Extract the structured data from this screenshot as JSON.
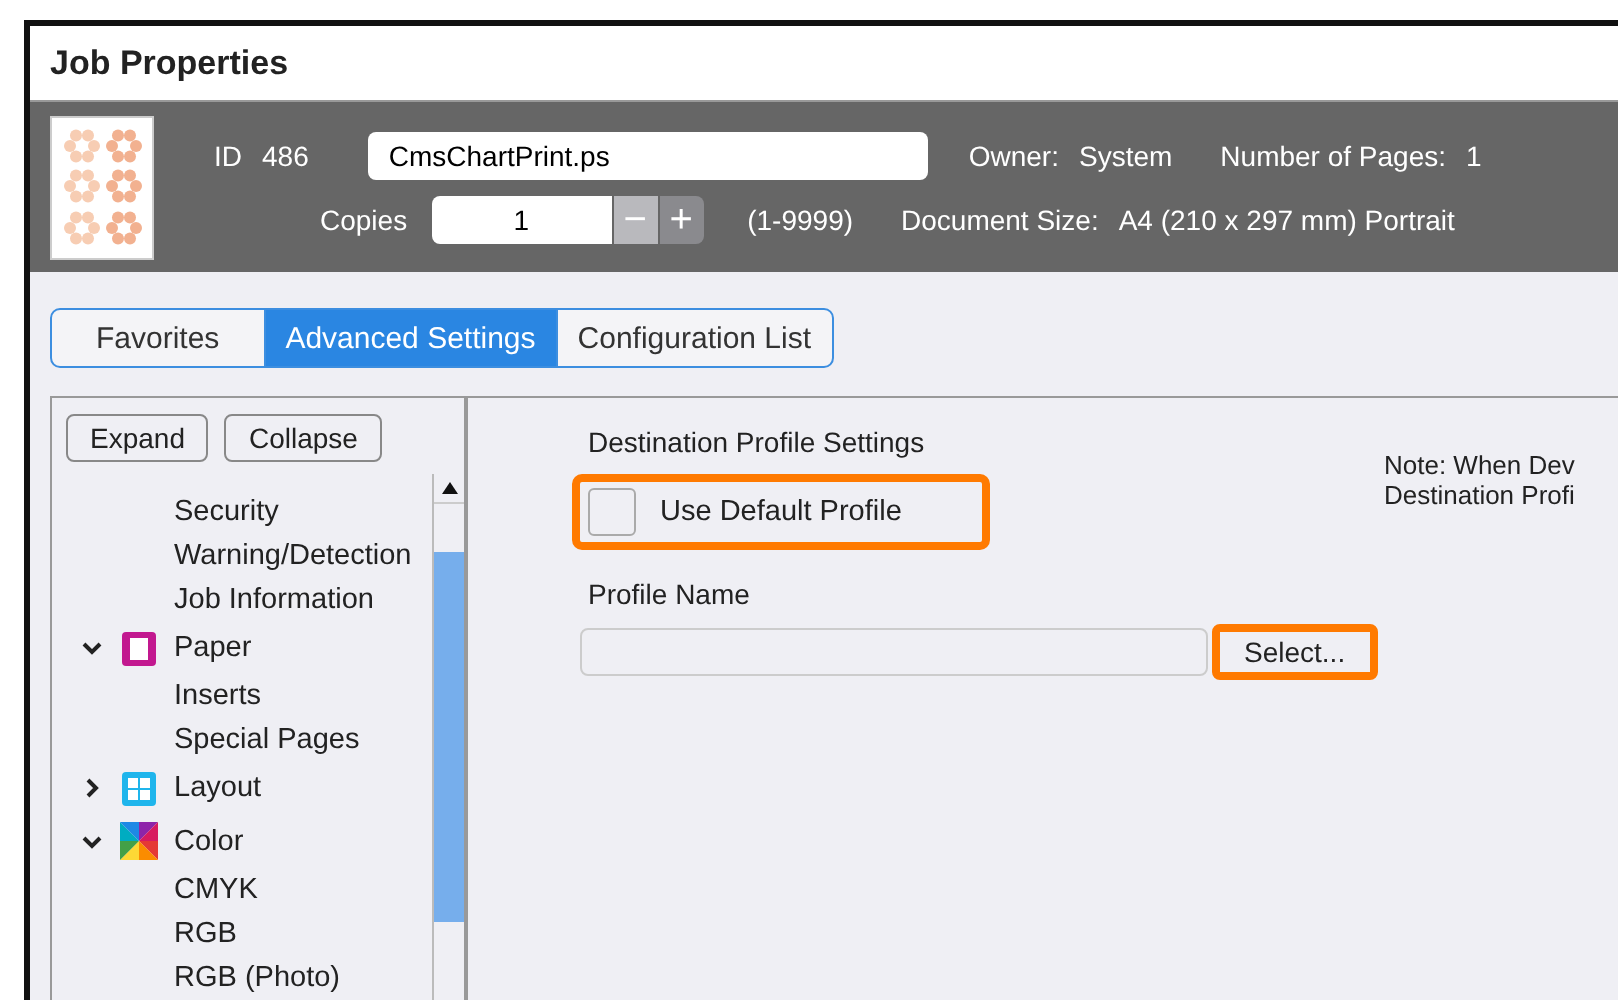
{
  "window": {
    "title": "Job Properties"
  },
  "job": {
    "id_label": "ID",
    "id": "486",
    "name": "CmsChartPrint.ps",
    "owner_label": "Owner:",
    "owner": "System",
    "pages_label": "Number of Pages:",
    "pages": "1",
    "copies_label": "Copies",
    "copies": "1",
    "minus": "−",
    "minus_disabled": true,
    "plus": "+",
    "plus_disabled": false,
    "copies_range": "(1-9999)",
    "size_label": "Document Size:",
    "size": "A4 (210 x 297 mm) Portrait"
  },
  "tabs": [
    {
      "label": "Favorites",
      "selected": false
    },
    {
      "label": "Advanced Settings",
      "selected": true
    },
    {
      "label": "Configuration List",
      "selected": false
    }
  ],
  "tree": {
    "buttons": [
      "Expand",
      "Collapse"
    ],
    "items": [
      {
        "children": [
          {
            "label": "Security"
          },
          {
            "label": "Warning/Detection"
          },
          {
            "label": "Job Information"
          }
        ]
      },
      {
        "label": "Paper",
        "kind": "paper",
        "expanded": true,
        "children": [
          {
            "label": "Inserts"
          },
          {
            "label": "Special Pages"
          }
        ]
      },
      {
        "label": "Layout",
        "kind": "layout",
        "expanded": false
      },
      {
        "label": "Color",
        "kind": "color",
        "expanded": true,
        "children": [
          {
            "label": "CMYK"
          },
          {
            "label": "RGB"
          },
          {
            "label": "RGB (Photo)"
          }
        ]
      }
    ]
  },
  "settings": {
    "heading": "Destination Profile Settings",
    "checkbox": {
      "label": "Use Default Profile",
      "checked": false,
      "highlighted": true
    },
    "profile_label": "Profile Name",
    "select_button": {
      "label": "Select...",
      "highlighted": true
    },
    "note": [
      "Note: When Dev",
      "Destination Profi"
    ]
  }
}
